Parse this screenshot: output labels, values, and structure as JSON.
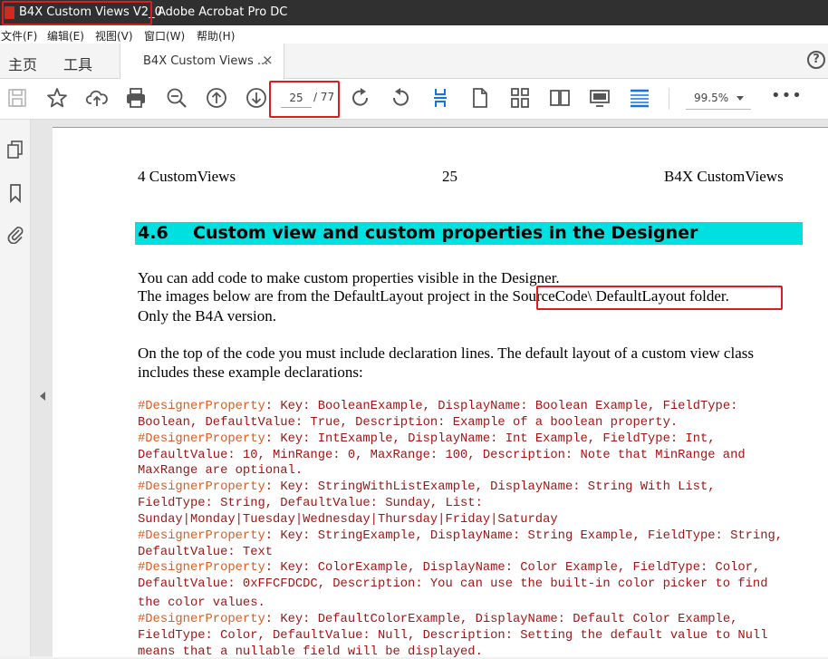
{
  "window": {
    "doc_title": "B4X Custom Views V2_0",
    "app_title": "Adobe Acrobat Pro DC"
  },
  "menu": [
    "文件(F)",
    "编辑(E)",
    "视图(V)",
    "窗口(W)",
    "帮助(H)"
  ],
  "tabs": {
    "home": "主页",
    "tools": "工具",
    "document": "B4X Custom Views ...",
    "close_glyph": "×"
  },
  "help_glyph": "?",
  "toolbar": {
    "icons": [
      "save-icon",
      "bookmark-star-icon",
      "cloud-upload-icon",
      "print-icon",
      "zoom-out-icon",
      "page-up-icon",
      "page-down-icon",
      "rotate-clockwise-icon",
      "rotate-counterclockwise-icon",
      "fit-width-icon",
      "single-page-icon",
      "scrolling-icon",
      "two-page-icon",
      "presentation-icon",
      "read-mode-icon",
      "more-icon"
    ],
    "current_page": "25",
    "total_pages": "/ 77",
    "zoom": "99.5%",
    "more_glyph": "•••"
  },
  "leftpanel": {
    "icons": [
      "pages-icon",
      "bookmark-icon",
      "attachment-icon"
    ]
  },
  "document": {
    "header_left": "4  CustomViews",
    "header_center": "25",
    "header_right": "B4X   CustomViews",
    "section_number": "4.6",
    "section_title": "Custom view and custom properties in the Designer",
    "paragraph1": [
      "You can add code to make custom properties visible in the Designer.",
      "The images below are from the DefaultLayout project in the SourceCode\\ DefaultLayout folder.",
      "Only the B4A version."
    ],
    "paragraph2": [
      "On the top of the code you must include declaration lines. The default layout of a custom view class",
      "includes these example declarations:"
    ],
    "code": [
      {
        "kw": "#DesignerProperty",
        "text": ": Key: BooleanExample, DisplayName: Boolean Example, FieldType:"
      },
      {
        "kw": "",
        "text": "Boolean, DefaultValue: True, Description: Example of a boolean property."
      },
      {
        "kw": "#DesignerProperty",
        "text": ": Key: IntExample, DisplayName: Int Example, FieldType: Int,"
      },
      {
        "kw": "",
        "text": "DefaultValue: 10, MinRange: 0, MaxRange: 100, Description: Note that MinRange and"
      },
      {
        "kw": "",
        "text": "MaxRange are optional."
      },
      {
        "kw": "#DesignerProperty",
        "text": ": Key: StringWithListExample, DisplayName: String With List,"
      },
      {
        "kw": "",
        "text": "FieldType: String, DefaultValue: Sunday, List:"
      },
      {
        "kw": "",
        "text": "Sunday|Monday|Tuesday|Wednesday|Thursday|Friday|Saturday"
      },
      {
        "kw": "#DesignerProperty",
        "text": ": Key: StringExample, DisplayName: String Example, FieldType: String,"
      },
      {
        "kw": "",
        "text": "DefaultValue: Text"
      },
      {
        "kw": "#DesignerProperty",
        "text": ": Key: ColorExample, DisplayName: Color Example, FieldType: Color,"
      },
      {
        "kw": "",
        "text": "DefaultValue: 0xFFCFDCDC, Description: You can use the built-in color picker to find"
      },
      {
        "kw": "",
        "text": "the color values."
      },
      {
        "kw": "#DesignerProperty",
        "text": ": Key: DefaultColorExample, DisplayName: Default Color Example,"
      },
      {
        "kw": "",
        "text": "FieldType: Color, DefaultValue: Null, Description: Setting the default value to Null"
      },
      {
        "kw": "",
        "text": "means that a nullable field will be displayed."
      }
    ]
  },
  "colors": {
    "titlebar": "#303030",
    "highlight_box": "#e11b1b",
    "section_bar": "#00e0e0",
    "code_text": "#a31515",
    "code_keyword": "#e05a1a",
    "icon_blue": "#1473e6"
  }
}
